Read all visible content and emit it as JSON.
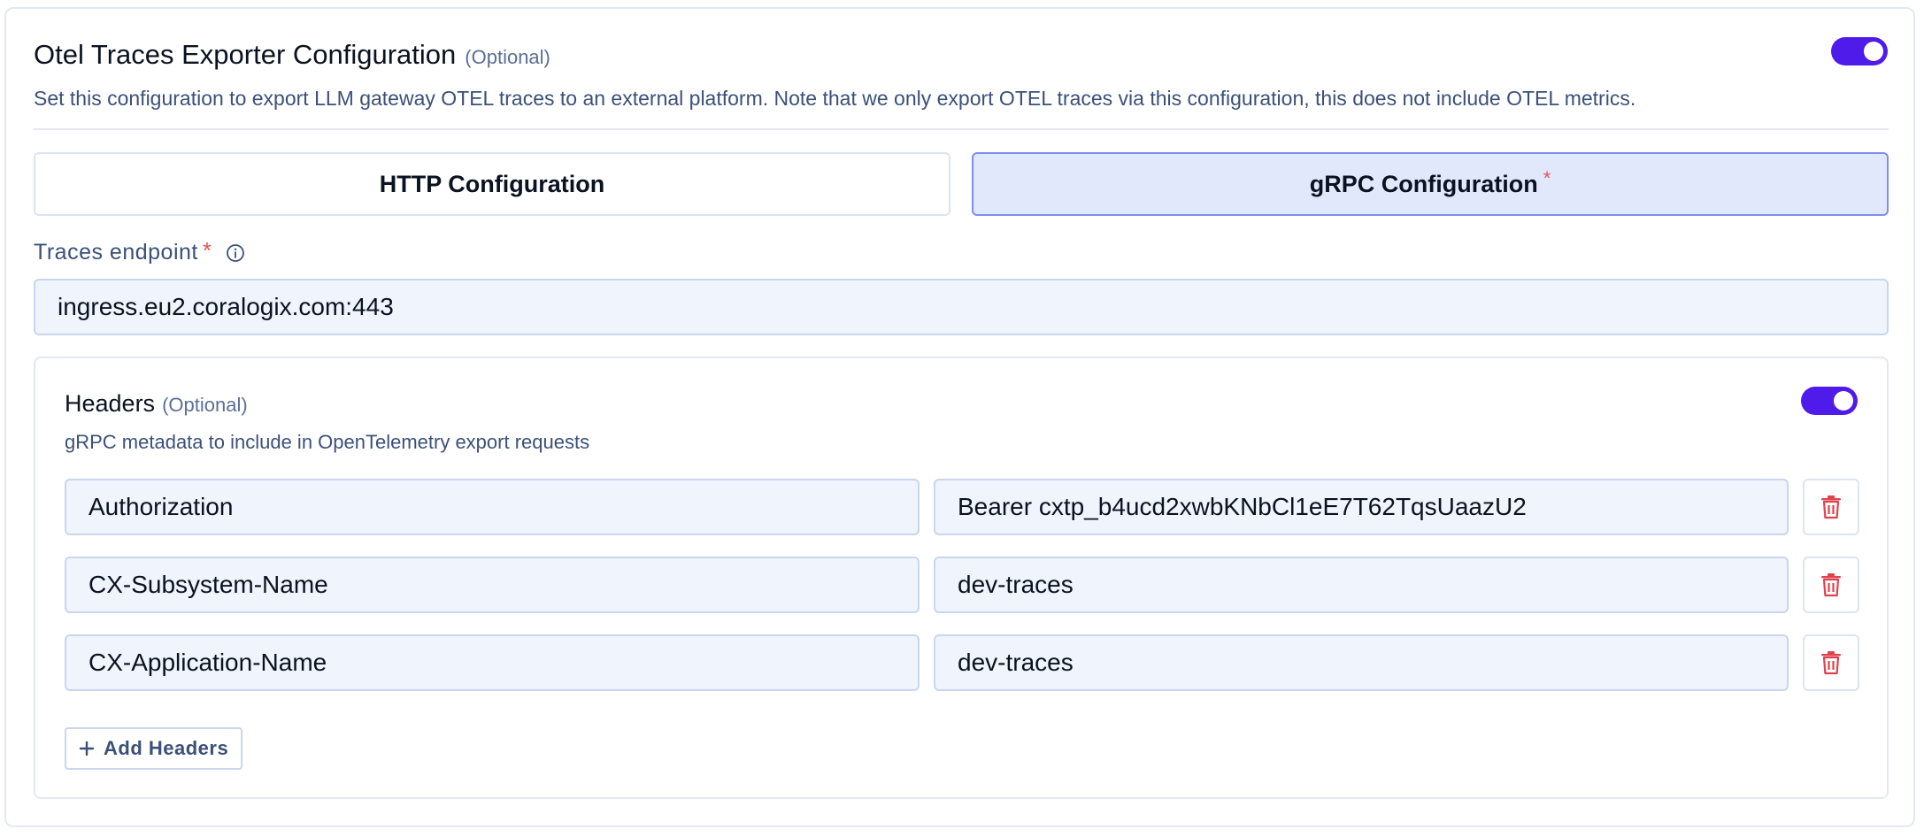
{
  "section": {
    "title": "Otel Traces Exporter Configuration",
    "optional_label": "(Optional)",
    "description": "Set this configuration to export LLM gateway OTEL traces to an external platform. Note that we only export OTEL traces via this configuration, this does not include OTEL metrics.",
    "enabled": true
  },
  "tabs": [
    {
      "label": "HTTP Configuration",
      "selected": false
    },
    {
      "label": "gRPC Configuration",
      "selected": true,
      "required_mark": "*"
    }
  ],
  "endpoint": {
    "label": "Traces endpoint",
    "required_mark": "*",
    "value": "ingress.eu2.coralogix.com:443"
  },
  "headers": {
    "title": "Headers",
    "optional_label": "(Optional)",
    "description": "gRPC metadata to include in OpenTelemetry export requests",
    "enabled": true,
    "rows": [
      {
        "key": "Authorization",
        "value": "Bearer cxtp_b4ucd2xwbKNbCl1eE7T62TqsUaazU2"
      },
      {
        "key": "CX-Subsystem-Name",
        "value": "dev-traces"
      },
      {
        "key": "CX-Application-Name",
        "value": "dev-traces"
      }
    ],
    "add_label": "Add Headers"
  },
  "colors": {
    "accent": "#4f1bea",
    "danger": "#e0434d",
    "selected_tab_bg": "#e2e8fb",
    "input_bg": "#eff4fd"
  },
  "icons": {
    "info": "info-icon",
    "delete": "trash-icon",
    "add": "plus-icon"
  }
}
